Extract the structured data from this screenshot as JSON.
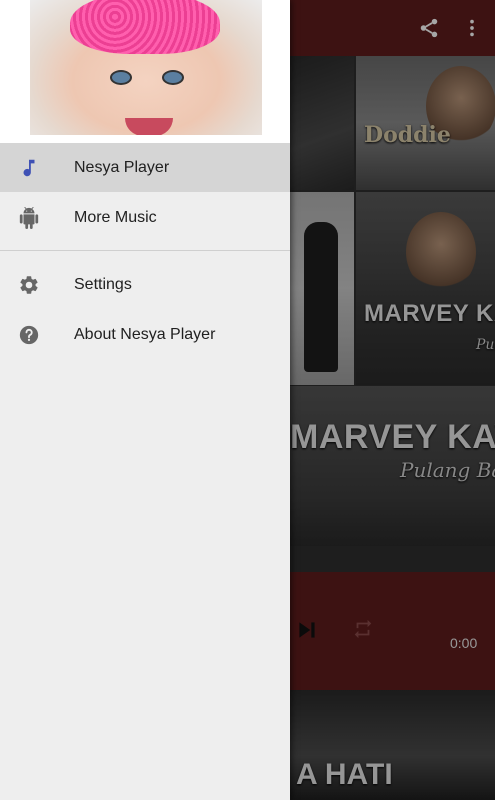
{
  "drawer": {
    "items": [
      {
        "label": "Nesya Player",
        "icon": "music-note-icon",
        "active": true
      },
      {
        "label": "More Music",
        "icon": "android-icon",
        "active": false
      },
      {
        "label": "Settings",
        "icon": "gear-icon",
        "active": false
      },
      {
        "label": "About Nesya Player",
        "icon": "help-circle-icon",
        "active": false
      }
    ]
  },
  "background": {
    "albums": [
      {
        "text": "Doddie"
      },
      {
        "text": "MARVEY KAYA",
        "subtitle": "Pulang Ba"
      },
      {
        "text": "MARVEY KAYA",
        "subtitle": "Pulang Ba"
      },
      {
        "text": "A HATI"
      }
    ],
    "player": {
      "elapsed": "0:00"
    }
  },
  "colors": {
    "accent": "#3f51b5",
    "toolbar": "#5e1d1d",
    "drawer_bg": "#eeeeee",
    "active_row": "#d5d5d5"
  }
}
